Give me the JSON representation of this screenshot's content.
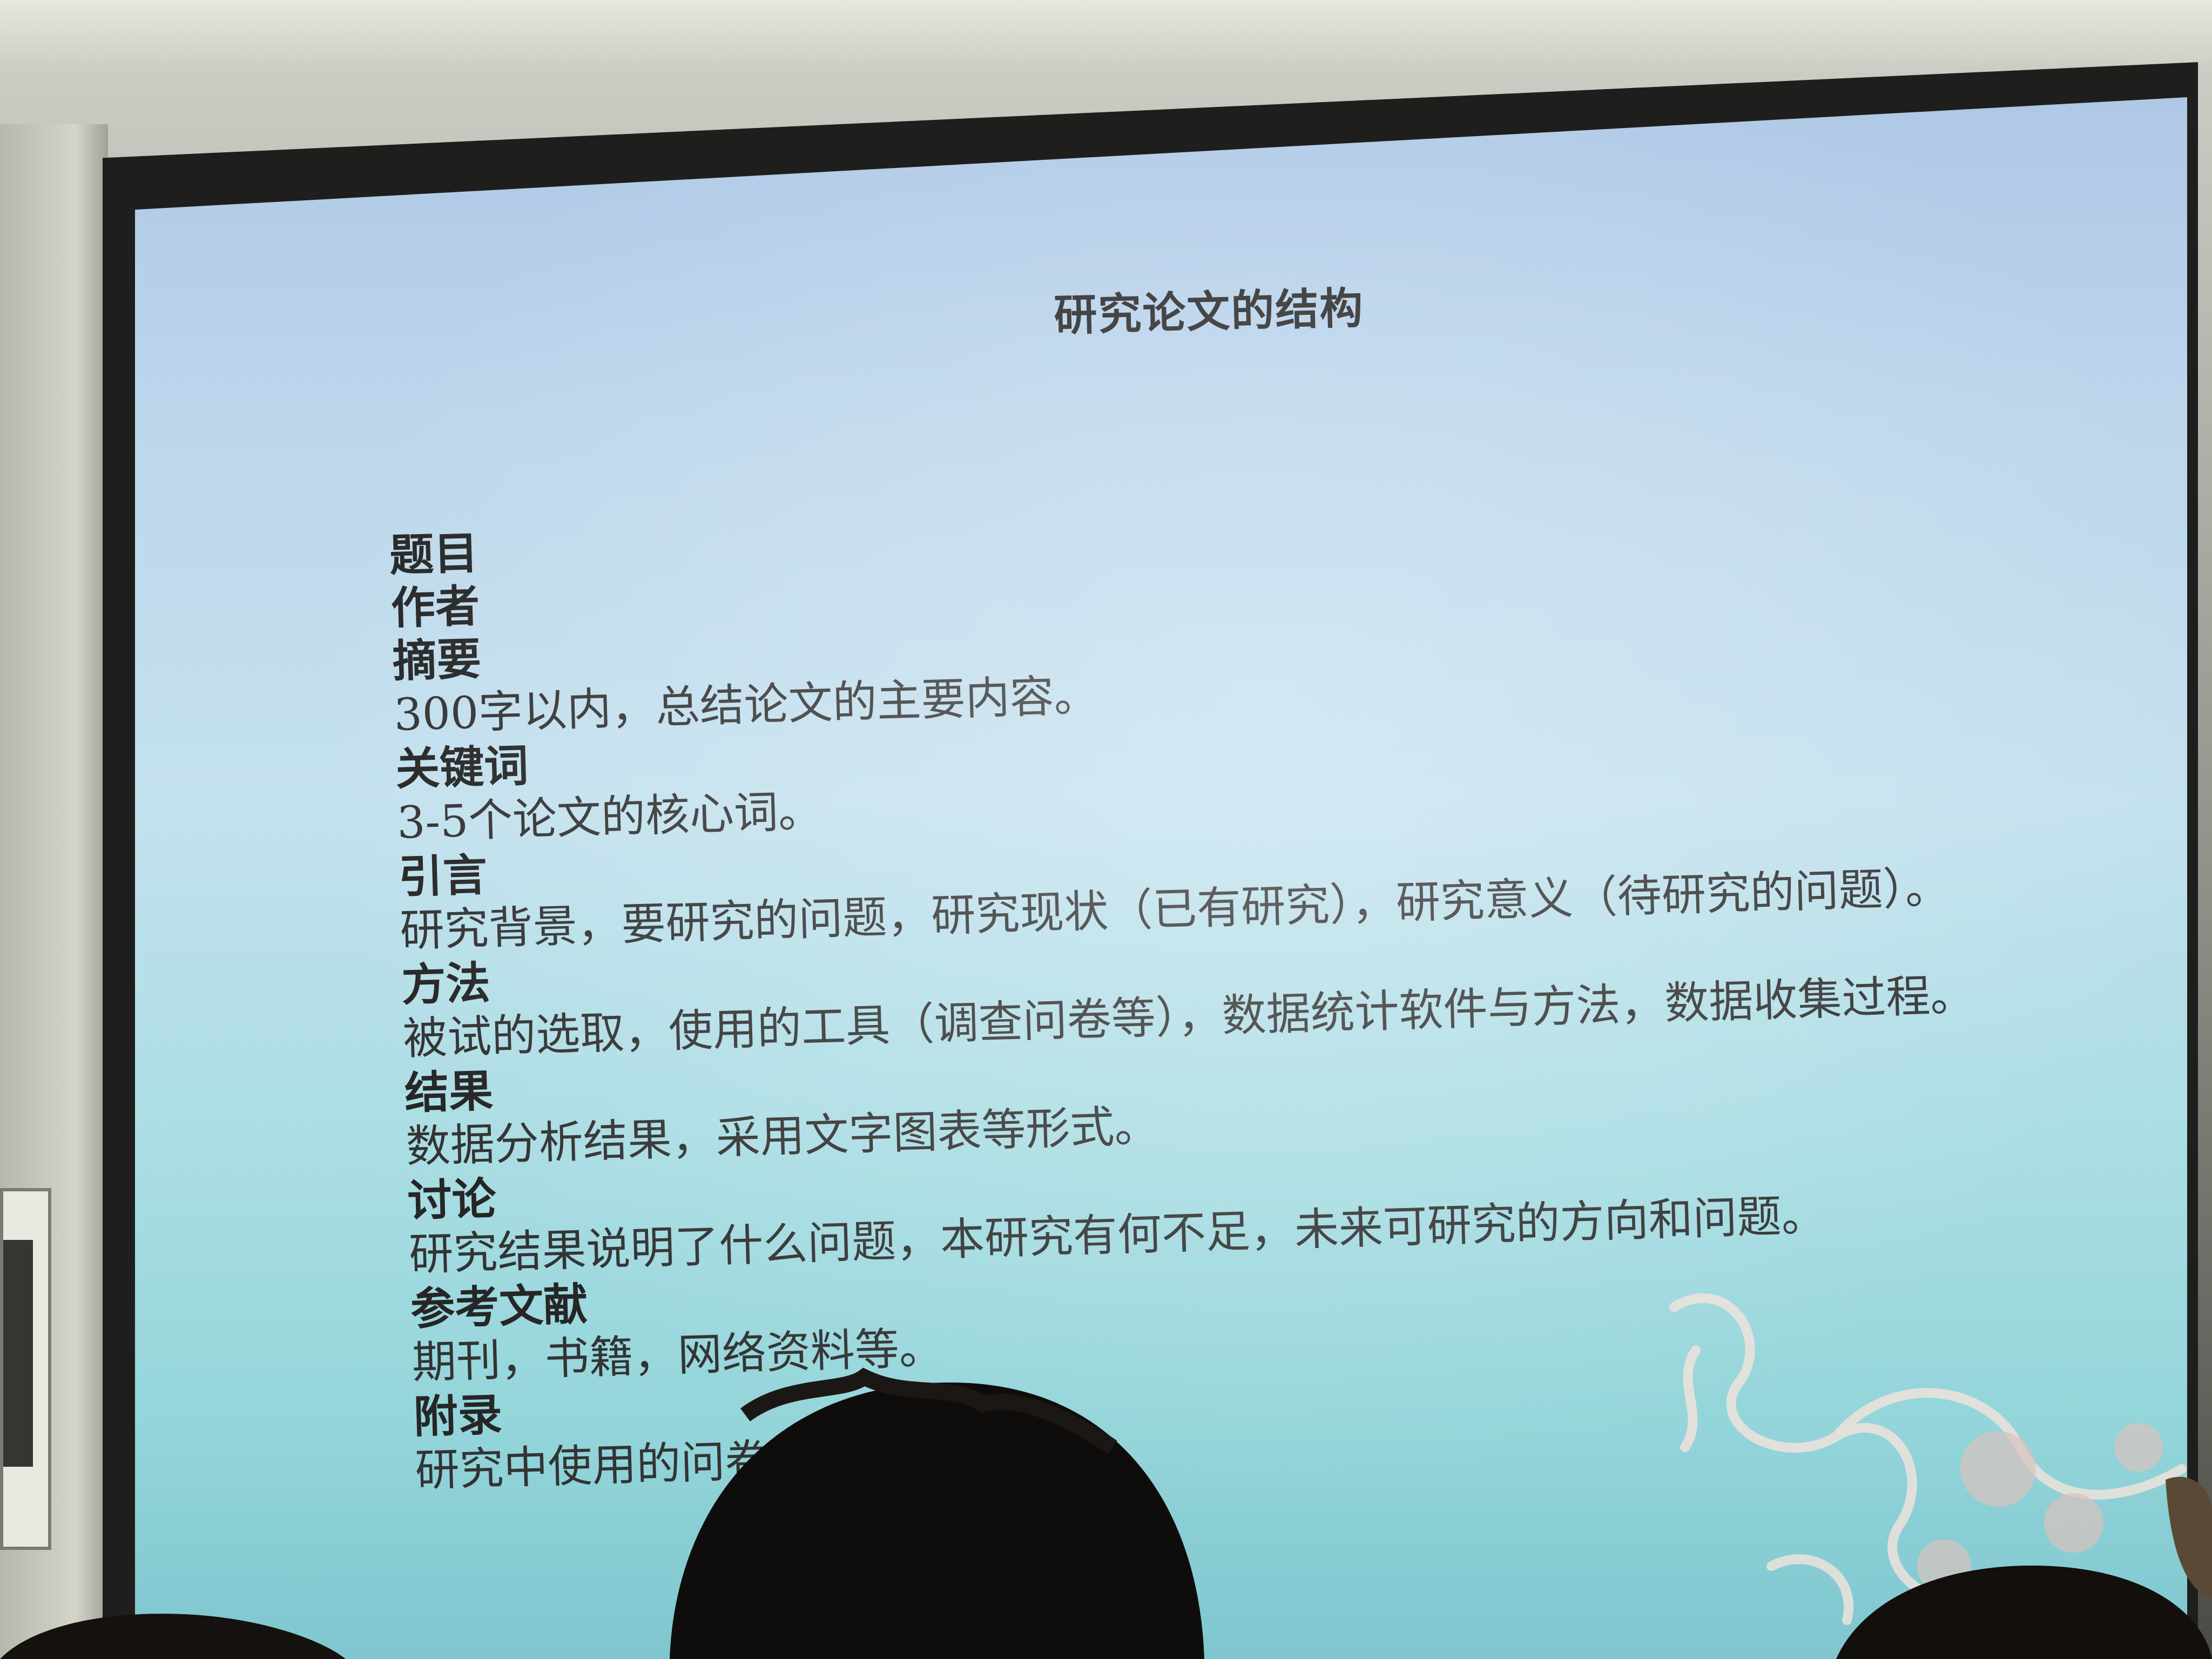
{
  "slide": {
    "title": "研究论文的结构",
    "sections": [
      {
        "heading": "题目",
        "description": ""
      },
      {
        "heading": "作者",
        "description": ""
      },
      {
        "heading": "摘要",
        "description": "300字以内，总结论文的主要内容。"
      },
      {
        "heading": "关键词",
        "description": "3-5个论文的核心词。"
      },
      {
        "heading": "引言",
        "description": "研究背景，要研究的问题，研究现状（已有研究），研究意义（待研究的问题）。"
      },
      {
        "heading": "方法",
        "description": "被试的选取，使用的工具（调查问卷等），数据统计软件与方法，数据收集过程。"
      },
      {
        "heading": "结果",
        "description": "数据分析结果，采用文字图表等形式。"
      },
      {
        "heading": "讨论",
        "description": "研究结果说明了什么问题，本研究有何不足，未来可研究的方向和问题。"
      },
      {
        "heading": "参考文献",
        "description": "期刊，书籍，网络资料等。"
      },
      {
        "heading": "附录",
        "description": "研究中使用的问卷、材料等。"
      }
    ]
  },
  "colors": {
    "projection_top": "#aec8e6",
    "projection_bottom": "#7fc6cf",
    "text": "#2b2b2b"
  }
}
